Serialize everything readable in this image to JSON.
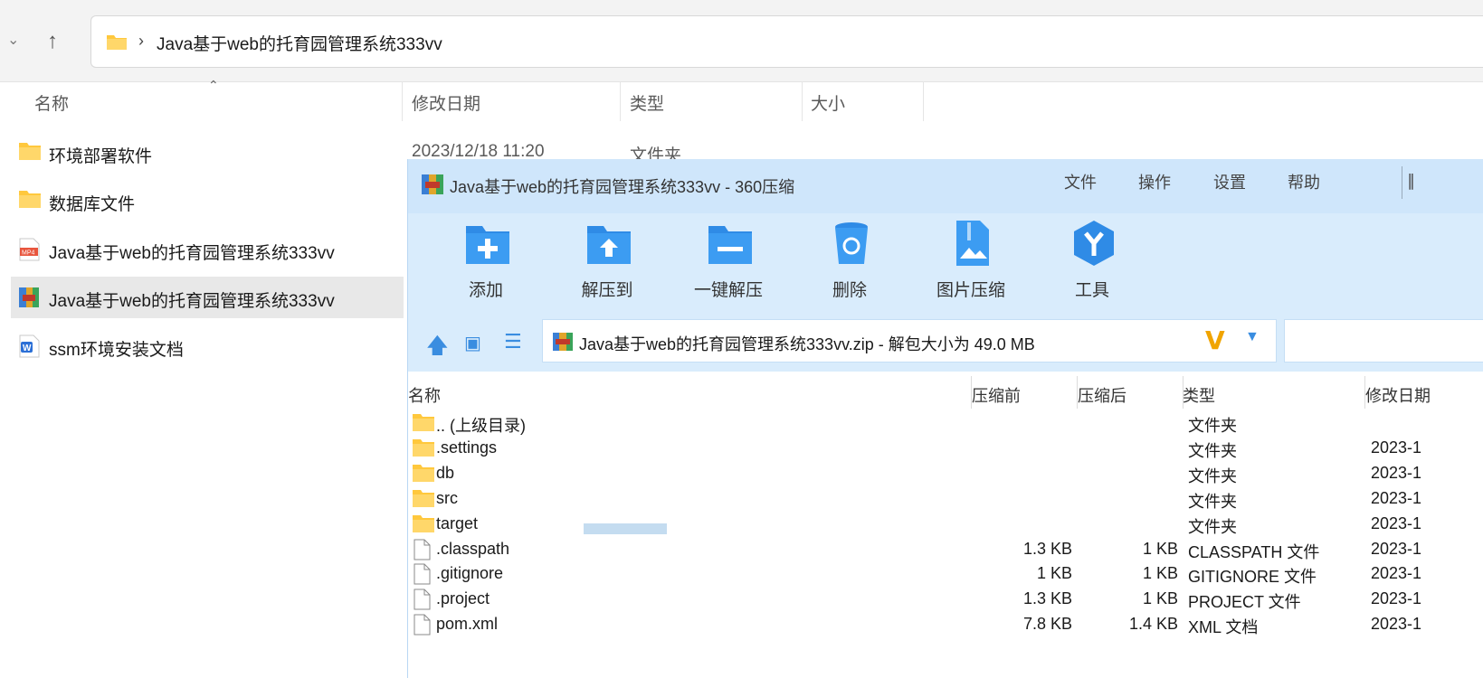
{
  "explorer": {
    "address": "Java基于web的托育园管理系统333vv",
    "columns": [
      "名称",
      "修改日期",
      "类型",
      "大小"
    ],
    "rows": [
      {
        "name": "环境部署软件",
        "icon": "folder-icon",
        "date": "2023/12/18 11:20",
        "type": "文件夹"
      },
      {
        "name": "数据库文件",
        "icon": "folder-icon"
      },
      {
        "name": "Java基于web的托育园管理系统333vv",
        "icon": "mp4-file-icon"
      },
      {
        "name": "Java基于web的托育园管理系统333vv",
        "icon": "zip-archive-icon",
        "selected": true
      },
      {
        "name": "ssm环境安装文档",
        "icon": "word-doc-icon"
      }
    ]
  },
  "zip": {
    "title": "Java基于web的托育园管理系统333vv - 360压缩",
    "menu": [
      "文件",
      "操作",
      "设置",
      "帮助"
    ],
    "toolbar": [
      {
        "label": "添加",
        "icon": "add-icon"
      },
      {
        "label": "解压到",
        "icon": "extract-to-icon"
      },
      {
        "label": "一键解压",
        "icon": "one-click-extract-icon"
      },
      {
        "label": "删除",
        "icon": "delete-icon"
      },
      {
        "label": "图片压缩",
        "icon": "image-compress-icon"
      },
      {
        "label": "工具",
        "icon": "tools-icon"
      }
    ],
    "address": "Java基于web的托育园管理系统333vv.zip - 解包大小为 49.0 MB",
    "columns": [
      "名称",
      "压缩前",
      "压缩后",
      "类型",
      "修改日期"
    ],
    "rows": [
      {
        "name": ".. (上级目录)",
        "before": "",
        "after": "",
        "type": "文件夹",
        "date": "",
        "icon": "folder-icon"
      },
      {
        "name": ".settings",
        "before": "",
        "after": "",
        "type": "文件夹",
        "date": "2023-1",
        "icon": "folder-icon"
      },
      {
        "name": "db",
        "before": "",
        "after": "",
        "type": "文件夹",
        "date": "2023-1",
        "icon": "folder-icon"
      },
      {
        "name": "src",
        "before": "",
        "after": "",
        "type": "文件夹",
        "date": "2023-1",
        "icon": "folder-icon"
      },
      {
        "name": "target",
        "before": "",
        "after": "",
        "type": "文件夹",
        "date": "2023-1",
        "icon": "folder-icon"
      },
      {
        "name": ".classpath",
        "before": "1.3 KB",
        "after": "1 KB",
        "type": "CLASSPATH 文件",
        "date": "2023-1",
        "icon": "file-icon"
      },
      {
        "name": ".gitignore",
        "before": "1 KB",
        "after": "1 KB",
        "type": "GITIGNORE 文件",
        "date": "2023-1",
        "icon": "file-icon"
      },
      {
        "name": ".project",
        "before": "1.3 KB",
        "after": "1 KB",
        "type": "PROJECT 文件",
        "date": "2023-1",
        "icon": "file-icon"
      },
      {
        "name": "pom.xml",
        "before": "7.8 KB",
        "after": "1.4 KB",
        "type": "XML 文档",
        "date": "2023-1",
        "icon": "file-icon"
      }
    ]
  },
  "colors": {
    "titlebar": "#cfe6fb",
    "toolbar": "#d9ecfc",
    "accent": "#3a8de0",
    "folder": "#ffc83d"
  }
}
